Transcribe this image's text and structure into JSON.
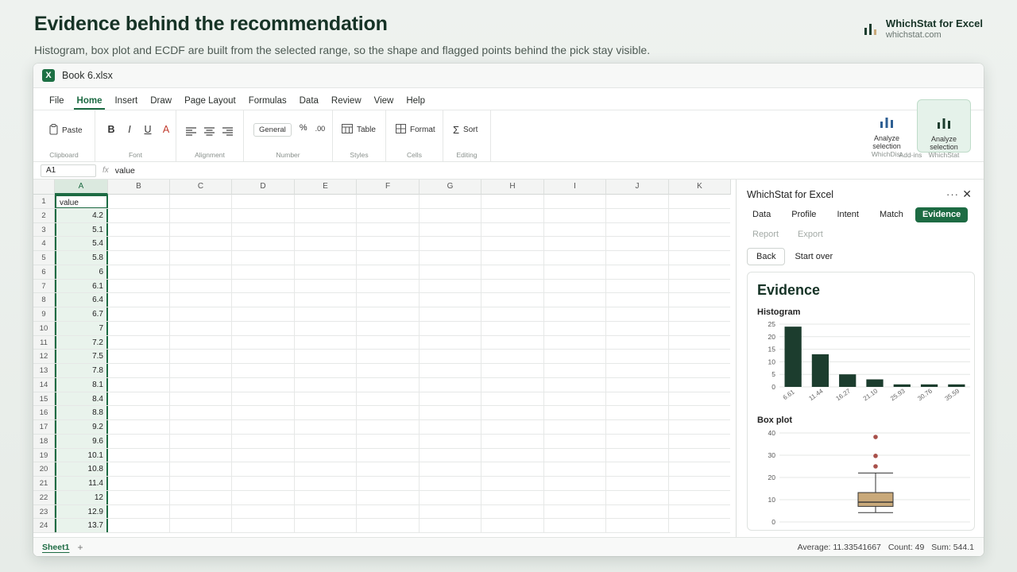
{
  "header": {
    "title": "Evidence behind the recommendation",
    "subtitle": "Histogram, box plot and ECDF are built from the selected range, so the shape and flagged points behind the pick stay visible."
  },
  "brand": {
    "name": "WhichStat for Excel",
    "site": "whichstat.com"
  },
  "window": {
    "doc_name": "Book 6.xlsx",
    "app_icon": "X"
  },
  "menu": [
    "File",
    "Home",
    "Insert",
    "Draw",
    "Page Layout",
    "Formulas",
    "Data",
    "Review",
    "View",
    "Help"
  ],
  "ribbon": {
    "clipboard": {
      "paste": "Paste",
      "label": "Clipboard"
    },
    "font": {
      "bold": "B",
      "italic": "I",
      "underline": "U",
      "color": "A",
      "label": "Font"
    },
    "alignment": {
      "label": "Alignment"
    },
    "number": {
      "format": "General",
      "percent": "%",
      "decimal": ".00",
      "label": "Number"
    },
    "styles": {
      "table": "Table",
      "label": "Styles"
    },
    "cells": {
      "format": "Format",
      "label": "Cells"
    },
    "editing": {
      "sigma": "Σ",
      "sort": "Sort",
      "label": "Editing"
    },
    "addins": {
      "label": "Add-ins",
      "whichdist": {
        "l1": "Analyze",
        "l2": "selection",
        "sub": "WhichDist"
      },
      "whichstat": {
        "l1": "Analyze",
        "l2": "selection",
        "sub": "WhichStat"
      }
    }
  },
  "formula_bar": {
    "cell": "A1",
    "fx": "fx",
    "value": "value"
  },
  "columns": [
    "A",
    "B",
    "C",
    "D",
    "E",
    "F",
    "G",
    "H",
    "I",
    "J",
    "K"
  ],
  "rows": [
    "1",
    "2",
    "3",
    "4",
    "5",
    "6",
    "7",
    "8",
    "9",
    "10",
    "11",
    "12",
    "13",
    "14",
    "15",
    "16",
    "17",
    "18",
    "19",
    "20",
    "21",
    "22",
    "23",
    "24"
  ],
  "column_a": [
    "value",
    "4.2",
    "5.1",
    "5.4",
    "5.8",
    "6",
    "6.1",
    "6.4",
    "6.7",
    "7",
    "7.2",
    "7.5",
    "7.8",
    "8.1",
    "8.4",
    "8.8",
    "9.2",
    "9.6",
    "10.1",
    "10.8",
    "11.4",
    "12",
    "12.9",
    "13.7"
  ],
  "status": {
    "sheet": "Sheet1",
    "add": "+",
    "average": "Average: 11.33541667",
    "count": "Count: 49",
    "sum": "Sum: 544.1"
  },
  "pane": {
    "title": "WhichStat for Excel",
    "more": "···",
    "close": "✕",
    "tabs": [
      {
        "label": "Data",
        "state": "normal"
      },
      {
        "label": "Profile",
        "state": "normal"
      },
      {
        "label": "Intent",
        "state": "normal"
      },
      {
        "label": "Match",
        "state": "normal"
      },
      {
        "label": "Evidence",
        "state": "active"
      },
      {
        "label": "Report",
        "state": "disabled"
      },
      {
        "label": "Export",
        "state": "disabled"
      }
    ],
    "back": "Back",
    "start_over": "Start over",
    "evidence_title": "Evidence",
    "histogram_title": "Histogram",
    "boxplot_title": "Box plot"
  },
  "colors": {
    "accent": "#1d6b43",
    "bar": "#1c3d2e",
    "box": "#c9a97a",
    "outlier": "#a8504a"
  },
  "chart_data": [
    {
      "type": "bar",
      "title": "Histogram",
      "categories": [
        "6.61",
        "11.44",
        "16.27",
        "21.10",
        "25.93",
        "30.76",
        "35.59"
      ],
      "values": [
        24,
        13,
        5,
        3,
        1,
        1,
        1
      ],
      "ylim": [
        0,
        25
      ],
      "yticks": [
        0,
        5,
        10,
        15,
        20,
        25
      ],
      "grid": true
    },
    {
      "type": "box",
      "title": "Box plot",
      "ylim": [
        0,
        40
      ],
      "yticks": [
        0,
        10,
        20,
        30,
        40
      ],
      "whisker_low": 4.2,
      "q1": 7,
      "median": 8.9,
      "q3": 13.2,
      "whisker_high": 22,
      "outliers": [
        25,
        29.7,
        38.2
      ],
      "grid": true
    }
  ]
}
